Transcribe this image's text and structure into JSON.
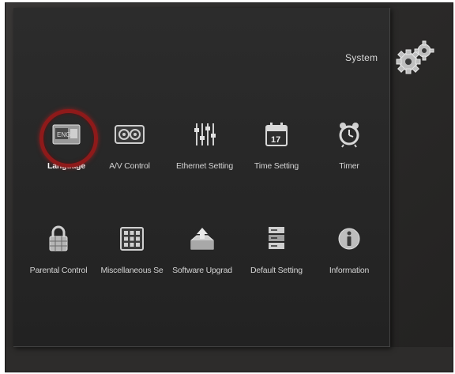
{
  "header": {
    "title": "System"
  },
  "menu": {
    "items": [
      {
        "label": "Language",
        "icon": "language-icon",
        "selected": true
      },
      {
        "label": "A/V Control",
        "icon": "av-control-icon"
      },
      {
        "label": "Ethernet Setting",
        "icon": "ethernet-setting-icon"
      },
      {
        "label": "Time Setting",
        "icon": "calendar-icon",
        "calendar_day": "17"
      },
      {
        "label": "Timer",
        "icon": "alarm-clock-icon"
      },
      {
        "label": "Parental Control",
        "icon": "lock-icon"
      },
      {
        "label": "Miscellaneous Se",
        "icon": "grid-icon"
      },
      {
        "label": "Software Upgrad",
        "icon": "upgrade-icon"
      },
      {
        "label": "Default Setting",
        "icon": "default-setting-icon"
      },
      {
        "label": "Information",
        "icon": "information-icon"
      }
    ]
  },
  "colors": {
    "focus_ring": "#8e1a1a",
    "panel": "#262626",
    "text": "#d2d2d2"
  }
}
